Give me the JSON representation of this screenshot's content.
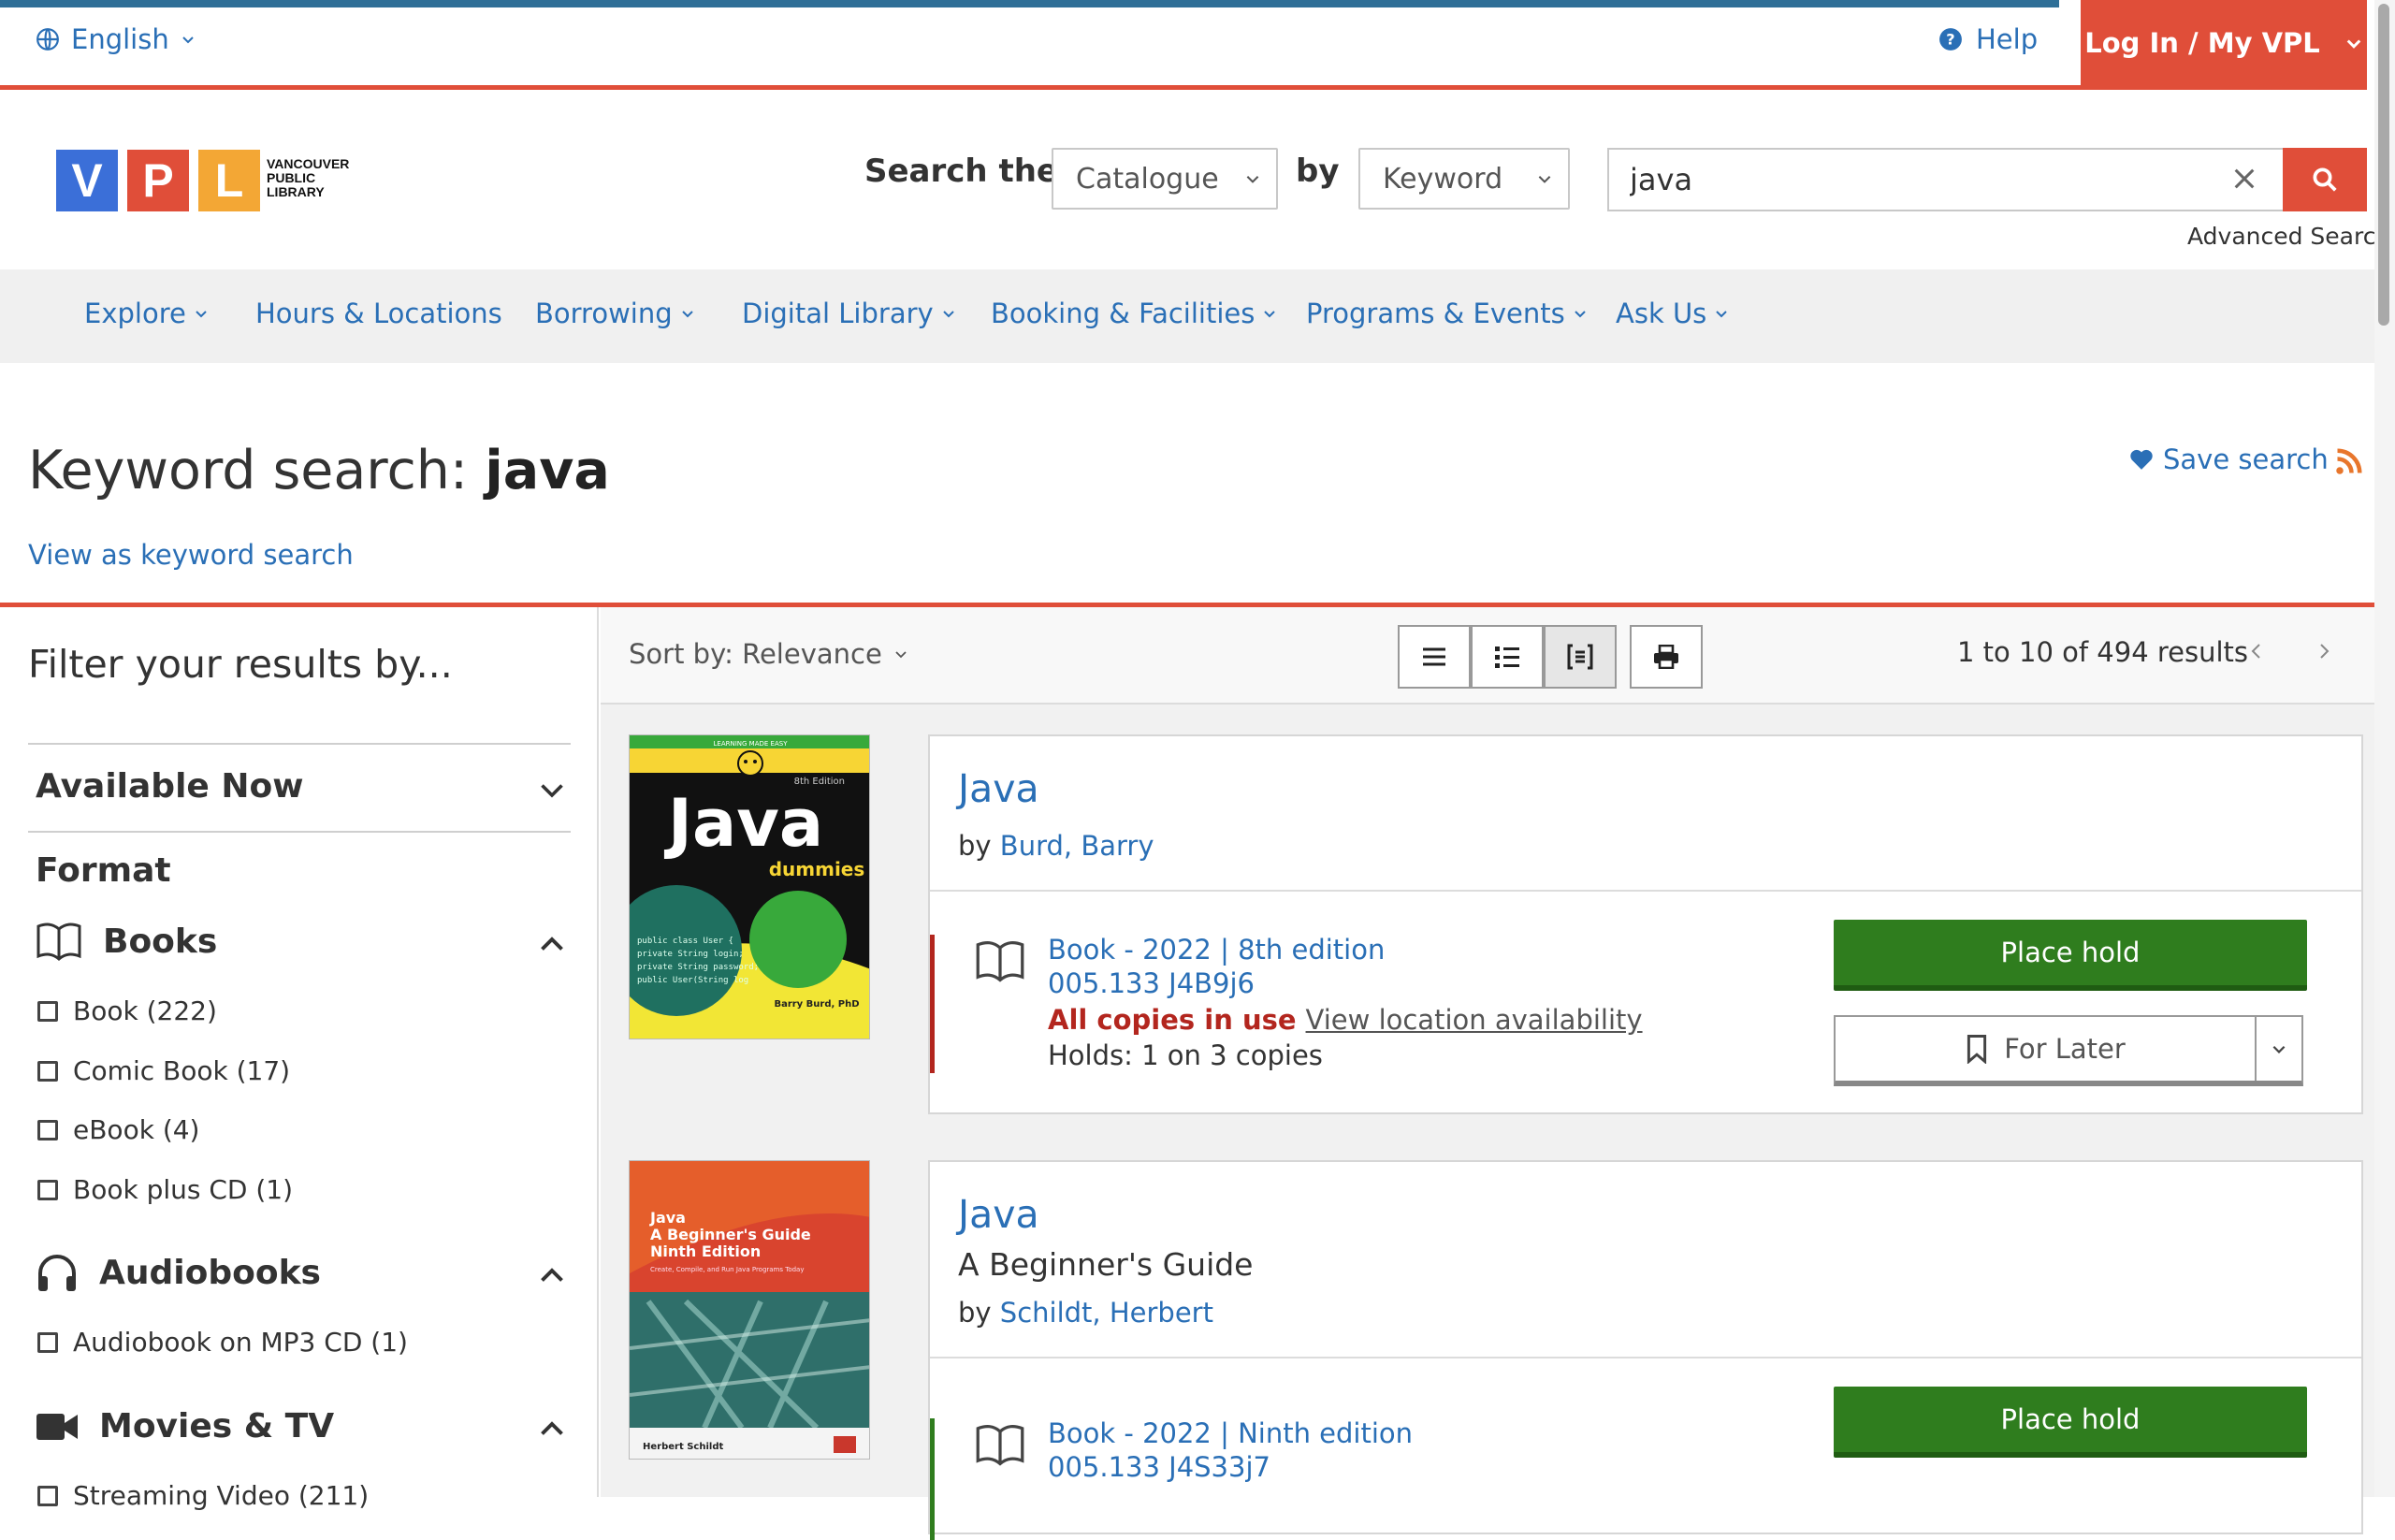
{
  "topbar": {
    "language": "English",
    "help": "Help",
    "login": "Log In / My VPL"
  },
  "logo": {
    "letters": [
      "V",
      "P",
      "L"
    ],
    "letter_colors": [
      "#3b6fd8",
      "#e04e39",
      "#f3a735"
    ],
    "text_lines": [
      "VANCOUVER",
      "PUBLIC",
      "LIBRARY"
    ]
  },
  "search": {
    "label": "Search the",
    "scope": "Catalogue",
    "by_label": "by",
    "type": "Keyword",
    "query": "java",
    "advanced": "Advanced Search"
  },
  "nav": {
    "items": [
      {
        "label": "Explore",
        "dropdown": true
      },
      {
        "label": "Hours & Locations",
        "dropdown": false
      },
      {
        "label": "Borrowing",
        "dropdown": true
      },
      {
        "label": "Digital Library",
        "dropdown": true
      },
      {
        "label": "Booking & Facilities",
        "dropdown": true
      },
      {
        "label": "Programs & Events",
        "dropdown": true
      },
      {
        "label": "Ask Us",
        "dropdown": true
      }
    ]
  },
  "page": {
    "heading_prefix": "Keyword search:",
    "heading_term": "java",
    "view_as": "View as keyword search",
    "save_search": "Save search"
  },
  "sidebar": {
    "title": "Filter your results by...",
    "available_now": "Available Now",
    "format_label": "Format",
    "groups": [
      {
        "label": "Books",
        "icon": "book-icon",
        "items": [
          "Book (222)",
          "Comic Book (17)",
          "eBook (4)",
          "Book plus CD (1)"
        ]
      },
      {
        "label": "Audiobooks",
        "icon": "headphones-icon",
        "items": [
          "Audiobook on MP3 CD (1)"
        ]
      },
      {
        "label": "Movies & TV",
        "icon": "video-camera-icon",
        "items": [
          "Streaming Video (211)"
        ]
      }
    ]
  },
  "toolbar": {
    "sort": "Sort by: Relevance",
    "count": "1 to 10 of 494 results"
  },
  "results": [
    {
      "title": "Java",
      "subtitle": "",
      "by_prefix": "by",
      "author": "Burd, Barry",
      "format": "Book - 2022 | 8th edition",
      "call_number": "005.133 J4B9j6",
      "status": "All copies in use",
      "location_link": "View location availability",
      "holds": "Holds: 1 on 3 copies",
      "place_hold": "Place hold",
      "for_later": "For Later",
      "cover": {
        "title": "Java",
        "subtitle": "dummies",
        "edition": "8th Edition",
        "author": "Barry Burd, PhD",
        "series": "LEARNING MADE EASY"
      }
    },
    {
      "title": "Java",
      "subtitle": "A Beginner's Guide",
      "by_prefix": "by",
      "author": "Schildt, Herbert",
      "format": "Book - 2022 | Ninth edition",
      "call_number": "005.133 J4S33j7",
      "place_hold": "Place hold",
      "cover": {
        "title_lines": [
          "Java",
          "A Beginner's Guide",
          "Ninth Edition"
        ],
        "tagline": "Create, Compile, and Run Java Programs Today",
        "author": "Herbert Schildt"
      }
    }
  ],
  "colors": {
    "accent_red": "#e04e39",
    "link_blue": "#2a6fb6",
    "hold_green": "#2f7d1e",
    "topbar_blue": "#2f6f97"
  }
}
